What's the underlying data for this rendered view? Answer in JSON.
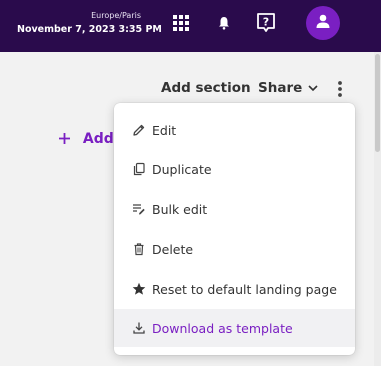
{
  "header": {
    "timezone": "Europe/Paris",
    "datetime": "November 7, 2023 3:35 PM",
    "icons": [
      "apps-grid-icon",
      "bell-icon",
      "help-icon",
      "user-avatar-icon"
    ],
    "colors": {
      "bar": "#2a0b4c",
      "avatar": "#7a1fc2"
    }
  },
  "toolbar": {
    "add_section_label": "Add section",
    "share_label": "Share"
  },
  "main": {
    "add_widget_label": "Add w"
  },
  "menu": {
    "items": [
      {
        "label": "Edit",
        "icon": "pencil-icon"
      },
      {
        "label": "Duplicate",
        "icon": "copy-icon"
      },
      {
        "label": "Bulk edit",
        "icon": "bulk-edit-icon"
      },
      {
        "label": "Delete",
        "icon": "trash-icon"
      },
      {
        "label": "Reset to default landing page",
        "icon": "star-icon"
      },
      {
        "label": "Download as template",
        "icon": "download-icon",
        "highlighted": true
      }
    ]
  },
  "accent_color": "#7a1fc2"
}
